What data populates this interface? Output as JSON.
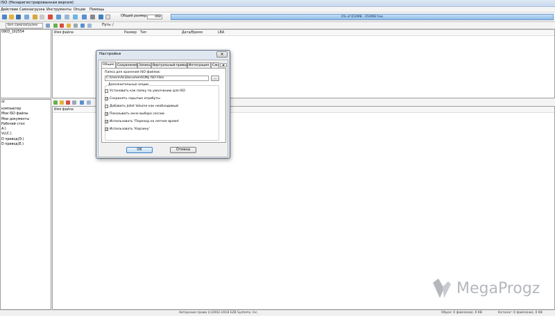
{
  "window": {
    "title": "ISO (Незарегистрированная версия)"
  },
  "menu": [
    "Действие",
    "Самозагрузка",
    "Инструменты",
    "Опции",
    "Помощь"
  ],
  "toolbar": {
    "total_size_label": "Общий размер:",
    "total_size_value": "0KB",
    "capacity_text": "0% of 650MB - 650MB free"
  },
  "pathbar": {
    "boot_button": "Без самозагрузки",
    "path_label": "Путь:",
    "path_value": "/"
  },
  "top_left_tree": [
    "0903_102554"
  ],
  "top_columns": [
    "Имя файла",
    "Размер",
    "Тип",
    "Дата/Время",
    "LBA"
  ],
  "bottom_left_tree": [
    "ог",
    "компьютер",
    "Мои ISO файлы",
    "Мои документы",
    "Рабочий стол",
    "A:)",
    "Vc(C:)",
    "D привод(D:)",
    "D привод(E:)"
  ],
  "bottom_columns": [
    "Имя файла"
  ],
  "statusbar": {
    "copyright": "Авторские права (c)2002-2018 EZB Systems, Inc.",
    "image": "Образ: 0 файла(ов), 0 KB",
    "catalog": "Каталог: 0 файла(ов), 0 KB"
  },
  "dialog": {
    "title": "Настройки",
    "close_glyph": "✕",
    "tabs": [
      "Общие",
      "Сохранение",
      "Запись",
      "Виртуальный привод",
      "Интеграция",
      "Сжа"
    ],
    "folder_label": "Папка для хранения ISO файлов:",
    "folder_value": "C:\\Users\\AL\\Documents\\My ISO Files",
    "browse_label": "...",
    "options_group": "Дополнительные опции",
    "options": [
      {
        "label": "Установить как папку по умолчанию для ISO",
        "checked": false
      },
      {
        "label": "Сохранять скрытые атрибуты",
        "checked": true
      },
      {
        "label": "Добавить Joliet Volume как необходимый",
        "checked": false
      },
      {
        "label": "Показывать окно выбора сессии",
        "checked": true
      },
      {
        "label": "Использовать 'Переход на летнее время'",
        "checked": true
      },
      {
        "label": "Использовать 'Корзину'",
        "checked": true
      }
    ],
    "ok_label": "OK",
    "cancel_label": "Отмена"
  },
  "watermark": {
    "text": "MegaProgz"
  },
  "colors": {
    "accent": "#3b7fc4",
    "size_bar": "#8fbde8"
  }
}
